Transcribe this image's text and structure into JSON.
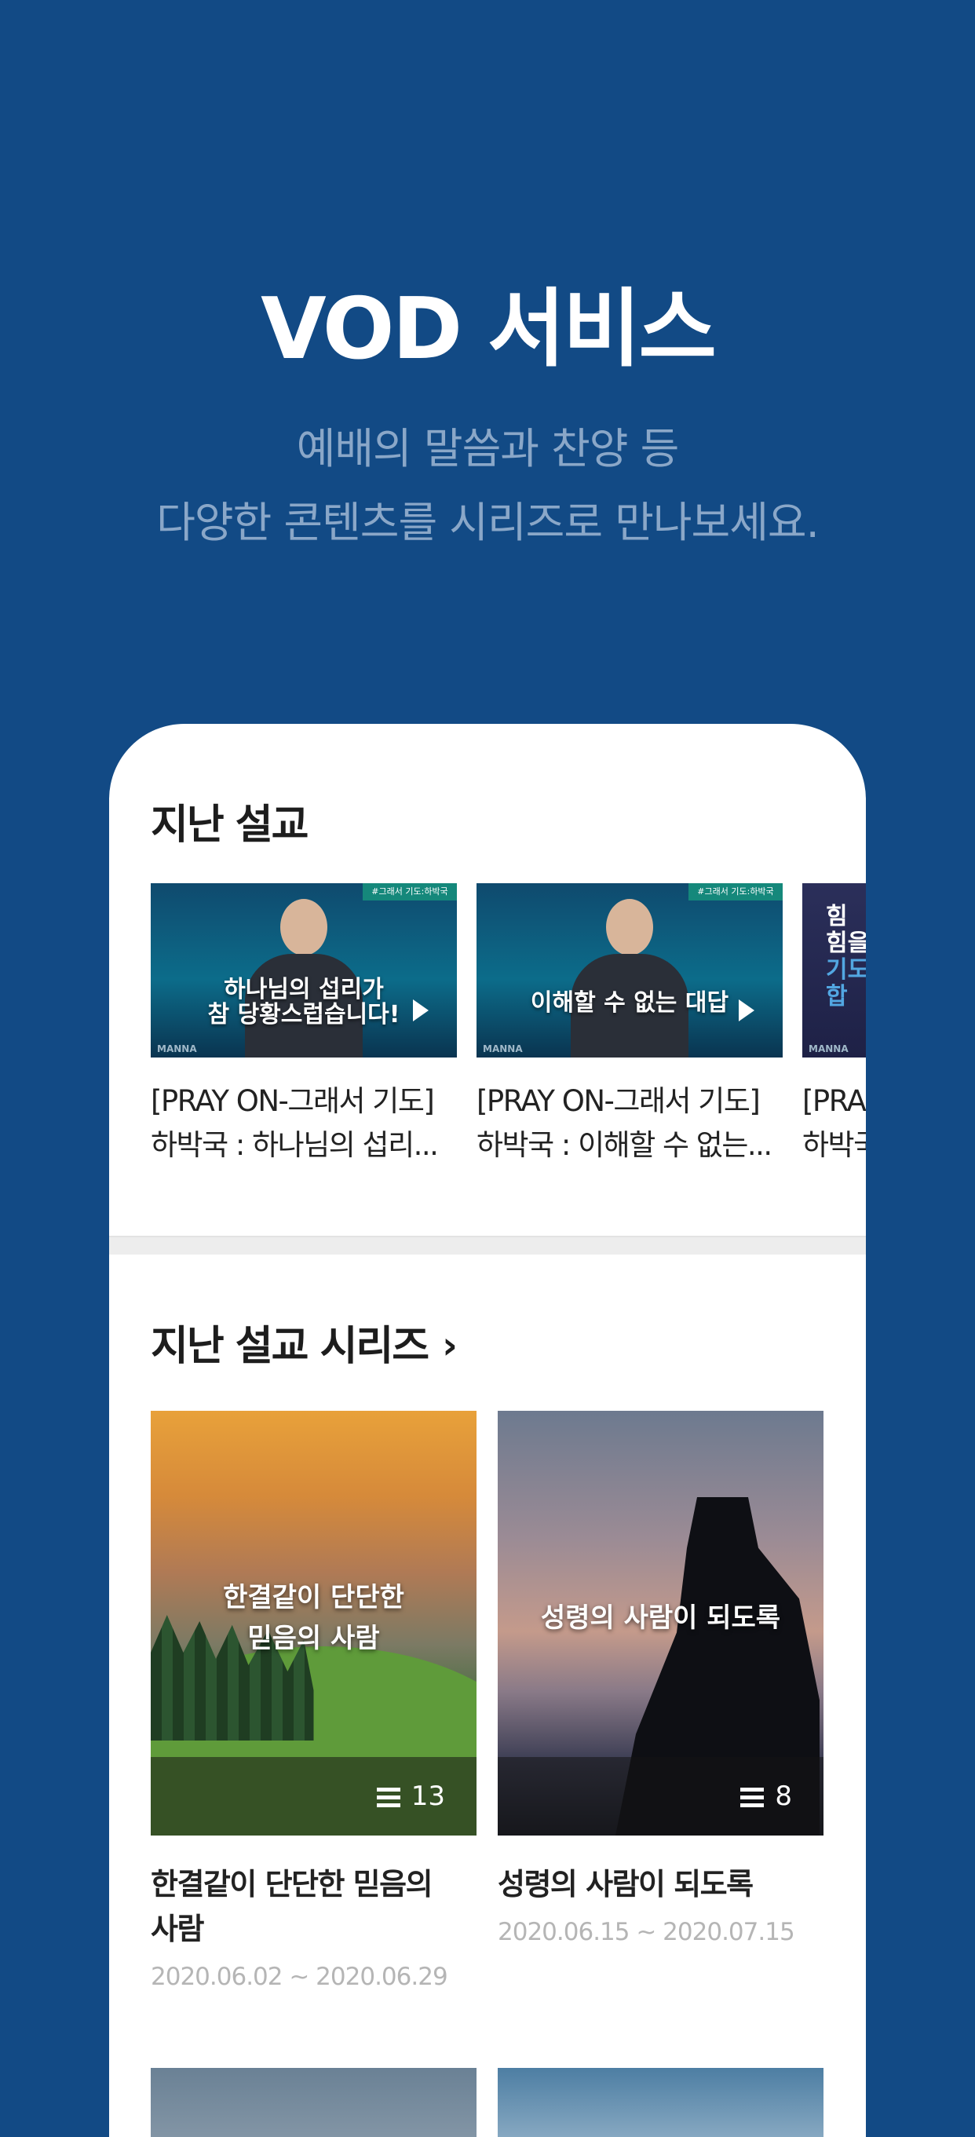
{
  "hero": {
    "title": "VOD 서비스",
    "subtitle_line1": "예배의 말씀과 찬양 등",
    "subtitle_line2": "다양한 콘텐츠를 시리즈로 만나보세요."
  },
  "past_sermons": {
    "title": "지난 설교",
    "items": [
      {
        "badge": "#그래서 기도:하박국",
        "caption_line1": "하나님의 섭리가",
        "caption_line2": "참 당황스럽습니다!",
        "brand": "MANNA",
        "title_line1": "[PRAY ON-그래서 기도]",
        "title_line2": "하박국 : 하나님의 섭리..."
      },
      {
        "badge": "#그래서 기도:하박국",
        "caption": "이해할 수 없는 대답",
        "brand": "MANNA",
        "title_line1": "[PRAY ON-그래서 기도]",
        "title_line2": "하박국 : 이해할 수 없는..."
      },
      {
        "caption_line1": "힘",
        "caption_line2": "힘을",
        "caption_line3": "기도",
        "caption_line4": "합",
        "brand": "MANNA",
        "title_line1": "[PRA",
        "title_line2": "하박국"
      }
    ]
  },
  "series": {
    "title": "지난 설교 시리즈",
    "chevron": "›",
    "items": [
      {
        "caption_line1": "한결같이 단단한",
        "caption_line2": "믿음의 사람",
        "count": "13",
        "title_line1": "한결같이 단단한 믿음의",
        "title_line2": "사람",
        "dates": "2020.06.02 ~ 2020.06.29"
      },
      {
        "caption": "성령의 사람이 되도록",
        "count": "8",
        "title": "성령의 사람이 되도록",
        "dates": "2020.06.15 ~ 2020.07.15"
      }
    ]
  },
  "colors": {
    "background": "#124a85",
    "subtitle": "#8aa7c8",
    "card": "#ffffff",
    "date_text": "#b5b5b5"
  },
  "icons": [
    "play-icon",
    "chevron-right-icon",
    "list-icon"
  ]
}
